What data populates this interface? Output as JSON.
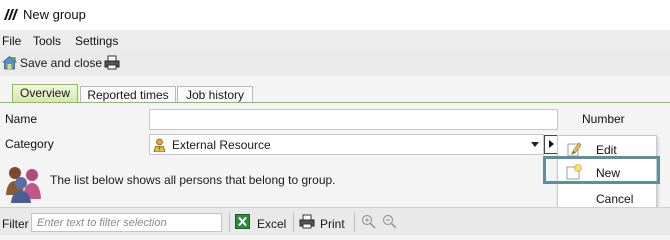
{
  "window": {
    "title": "New group",
    "logo_icon": "app-logo-icon"
  },
  "menu": {
    "items": [
      "File",
      "Tools",
      "Settings"
    ]
  },
  "toolbar": {
    "save_label": "Save and close",
    "save_icon": "save-close-icon",
    "print_icon": "print-icon"
  },
  "tabs": [
    {
      "label": "Overview",
      "active": true
    },
    {
      "label": "Reported times",
      "active": false
    },
    {
      "label": "Job history",
      "active": false
    }
  ],
  "form": {
    "name_label": "Name",
    "name_value": "",
    "number_label": "Number",
    "category_label": "Category",
    "category_value": "External Resource",
    "category_icon": "external-resource-icon",
    "info_text": "The list below shows all persons that belong to group."
  },
  "context_menu": {
    "items": [
      {
        "label": "Edit",
        "icon": "edit-icon"
      },
      {
        "label": "New",
        "icon": "new-icon",
        "highlighted": true
      },
      {
        "label": "Cancel",
        "icon": ""
      }
    ]
  },
  "filterbar": {
    "filter_label": "Filter",
    "filter_placeholder": "Enter text to filter selection",
    "excel_label": "Excel",
    "print_label": "Print",
    "zoom_in_icon": "zoom-in-icon",
    "zoom_out_icon": "zoom-out-icon"
  },
  "colors": {
    "accent_green": "#8cbf4f",
    "highlight_border": "#5e8f9a"
  }
}
